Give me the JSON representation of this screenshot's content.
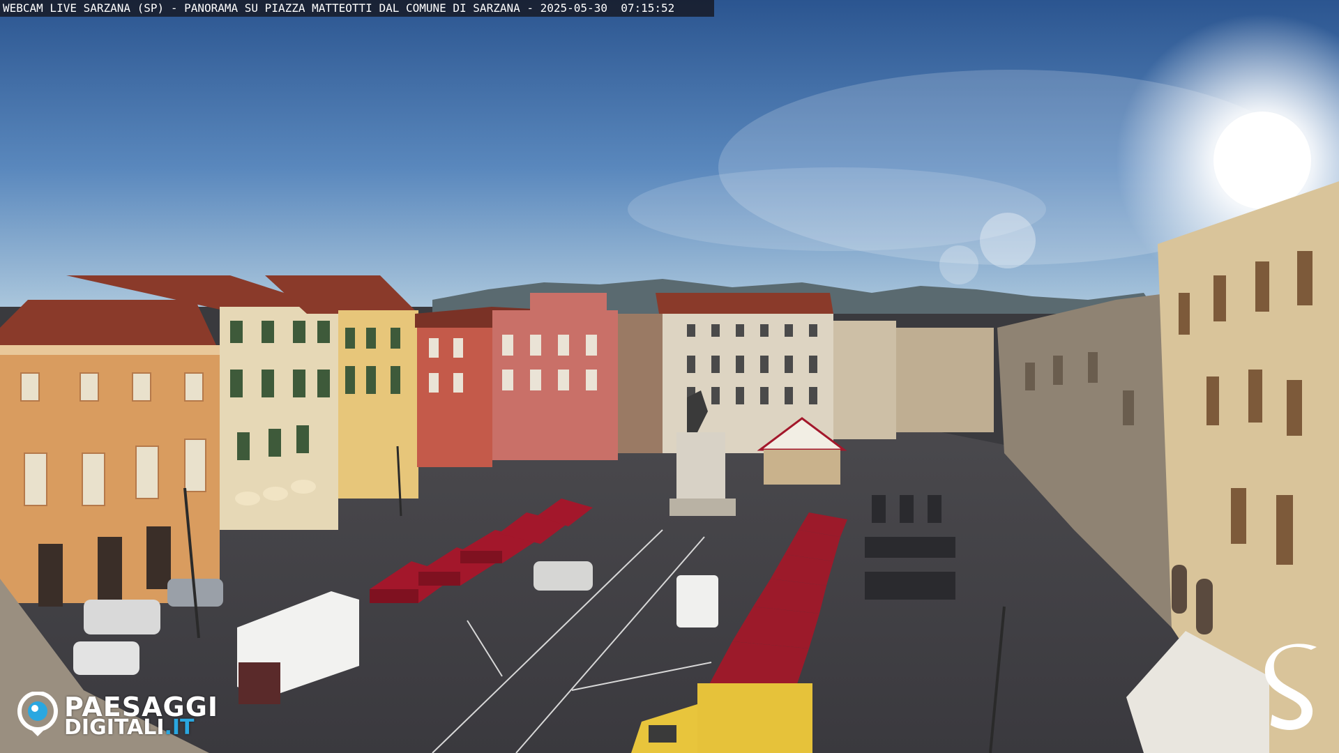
{
  "overlay": {
    "title": "WEBCAM LIVE SARZANA (SP) - PANORAMA SU PIAZZA MATTEOTTI DAL COMUNE DI SARZANA - 2025-05-30  07:15:52"
  },
  "branding": {
    "left_logo_line1": "PAESAGGI",
    "left_logo_line2a": "DIGITALI",
    "left_logo_line2b": ".IT",
    "left_logo_accent": "#2aa7e0",
    "right_logo_letter": "S"
  },
  "scene": {
    "sky_top": "#2f5b93",
    "sky_horizon": "#a9c6de",
    "sun_glow": "#ffffff",
    "building_ochre": "#d99c5f",
    "building_cream": "#e6d8b6",
    "building_red": "#c45a4a",
    "roof_terracotta": "#8a3a2a",
    "pavement": "#3f3e44",
    "market_canopy": "#a3172b"
  }
}
